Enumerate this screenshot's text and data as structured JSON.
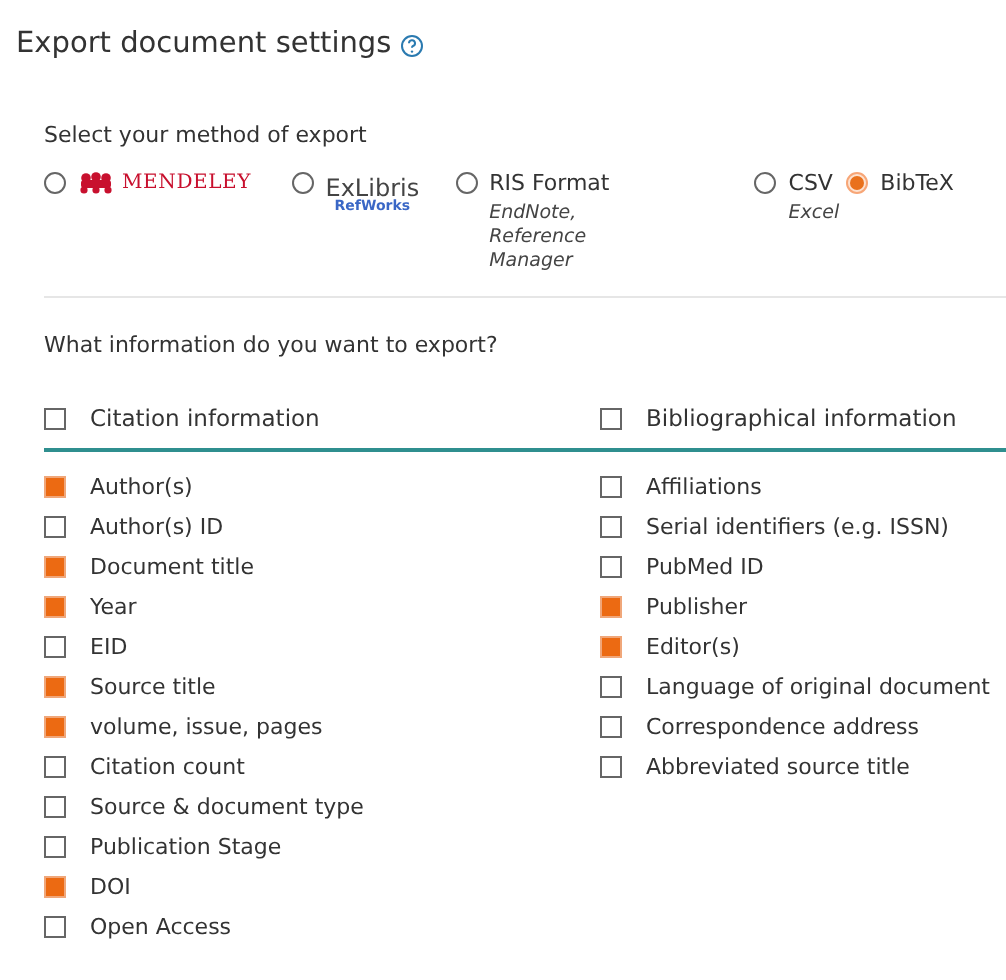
{
  "title": "Export document settings",
  "method": {
    "label": "Select your method of export",
    "options": [
      {
        "kind": "mendeley",
        "label": "MENDELEY",
        "selected": false
      },
      {
        "kind": "exlibris",
        "label": "ExLibris",
        "sublabel": "RefWorks",
        "selected": false
      },
      {
        "kind": "text",
        "label": "RIS Format",
        "note": "EndNote, Reference Manager",
        "selected": false
      },
      {
        "kind": "text",
        "label": "CSV",
        "note": "Excel",
        "selected": false
      },
      {
        "kind": "text",
        "label": "BibTeX",
        "selected": true
      }
    ]
  },
  "question": "What information do you want to export?",
  "groups": [
    {
      "label": "Citation information",
      "checked": false,
      "items": [
        {
          "label": "Author(s)",
          "checked": true
        },
        {
          "label": "Author(s) ID",
          "checked": false
        },
        {
          "label": "Document title",
          "checked": true
        },
        {
          "label": "Year",
          "checked": true
        },
        {
          "label": "EID",
          "checked": false
        },
        {
          "label": "Source title",
          "checked": true
        },
        {
          "label": "volume, issue, pages",
          "checked": true
        },
        {
          "label": "Citation count",
          "checked": false
        },
        {
          "label": "Source & document type",
          "checked": false
        },
        {
          "label": "Publication Stage",
          "checked": false
        },
        {
          "label": "DOI",
          "checked": true
        },
        {
          "label": "Open Access",
          "checked": false
        }
      ]
    },
    {
      "label": "Bibliographical information",
      "checked": false,
      "items": [
        {
          "label": "Affiliations",
          "checked": false
        },
        {
          "label": "Serial identifiers (e.g. ISSN)",
          "checked": false
        },
        {
          "label": "PubMed ID",
          "checked": false
        },
        {
          "label": "Publisher",
          "checked": true
        },
        {
          "label": "Editor(s)",
          "checked": true
        },
        {
          "label": "Language of original document",
          "checked": false
        },
        {
          "label": "Correspondence address",
          "checked": false
        },
        {
          "label": "Abbreviated source title",
          "checked": false
        }
      ]
    }
  ]
}
